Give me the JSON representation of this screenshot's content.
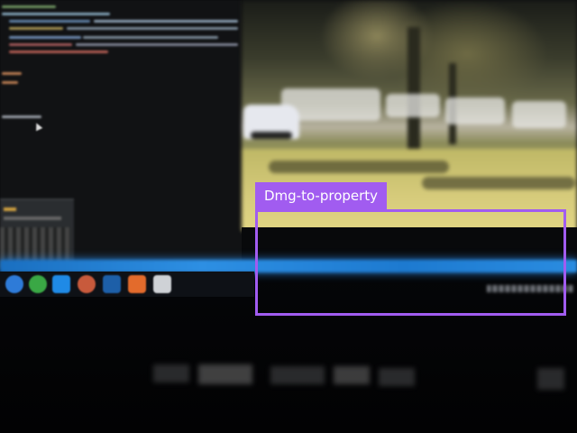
{
  "annotation": {
    "label": "Dmg-to-property",
    "color": "#a15cf0",
    "text_color": "#ffffff"
  },
  "scene": {
    "left_monitor": "code-editor",
    "right_monitor": "video-frame",
    "desk_light_color": "#2d8fe3"
  },
  "taskbar": {
    "icons": [
      {
        "name": "chrome-icon",
        "color": "#2e7bd8"
      },
      {
        "name": "opera-icon",
        "color": "#3aa845"
      },
      {
        "name": "vscode-icon",
        "color": "#1f8ae6"
      },
      {
        "name": "obs-icon",
        "color": "#c85a3c"
      },
      {
        "name": "steam-icon",
        "color": "#1d5fa8"
      },
      {
        "name": "sublime-icon",
        "color": "#e36b2c"
      },
      {
        "name": "files-icon",
        "color": "#cfd2d6"
      }
    ]
  }
}
